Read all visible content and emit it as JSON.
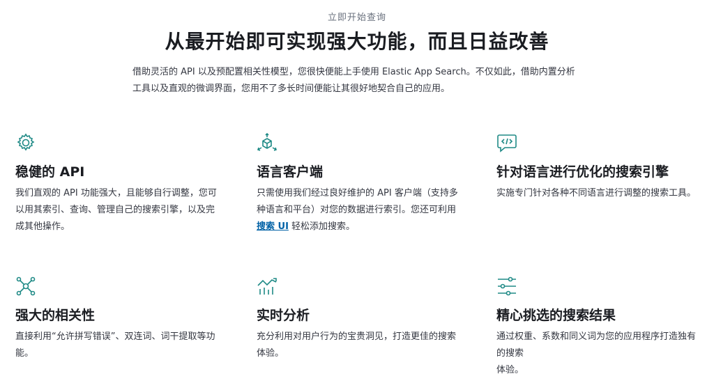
{
  "hero": {
    "eyebrow": "立即开始查询",
    "title": "从最开始即可实现强大功能，而且日益改善",
    "intro": "借助灵活的 API 以及预配置相关性模型，您很快便能上手使用 Elastic App Search。不仅如此，借助内置分析工具以及直观的微调界面，您用不了多长时间便能让其很好地契合自己的应用。"
  },
  "features": [
    {
      "icon": "gear-icon",
      "title": "稳健的 API",
      "desc": "我们直观的 API 功能强大，且能够自行调整，您可以用其索引、查询、管理自己的搜索引擎，以及完成其他操作。"
    },
    {
      "icon": "cube-icon",
      "title": "语言客户端",
      "desc_before": "只需使用我们经过良好维护的 API 客户端（支持多种语言和平台）对您的数据进行索引。您还可利用",
      "link": "搜索 UI",
      "desc_after": " 轻松添加搜索。"
    },
    {
      "icon": "code-chat-icon",
      "title": "针对语言进行优化的搜索引擎",
      "desc": "实施专门针对各种不同语言进行调整的搜索工具。"
    },
    {
      "icon": "network-icon",
      "title": "强大的相关性",
      "desc": "直接利用“允许拼写错误”、双连词、词干提取等功能。"
    },
    {
      "icon": "analytics-icon",
      "title": "实时分析",
      "desc": "充分利用对用户行为的宝贵洞见，打造更佳的搜索体验。"
    },
    {
      "icon": "sliders-icon",
      "title": "精心挑选的搜索结果",
      "desc": "通过权重、系数和同义词为您的应用程序打造独有的搜索",
      "desc2": "体验。"
    }
  ]
}
